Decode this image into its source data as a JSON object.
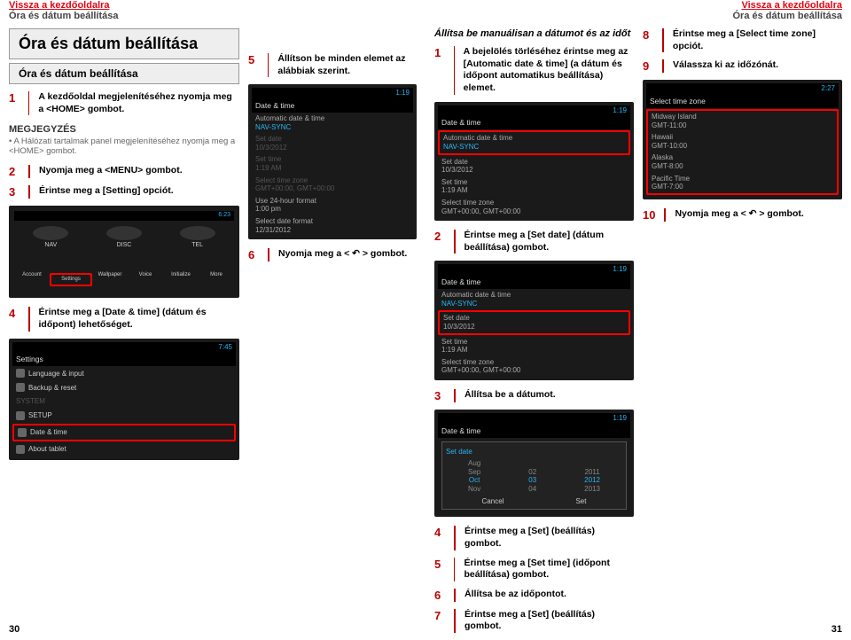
{
  "header": {
    "home": "Vissza a kezdőoldalra",
    "crumb": "Óra és dátum beállítása"
  },
  "left": {
    "title": "Óra és dátum beállítása",
    "subtitle": "Óra és dátum beállítása",
    "s1": "A kezdőoldal megjelenítéséhez nyomja meg a <HOME> gombot.",
    "note_t": "MEGJEGYZÉS",
    "note_b": "• A Hálózati tartalmak panel megjelenítéséhez nyomja meg a <HOME> gombot.",
    "s2": "Nyomja meg a <MENU> gombot.",
    "s3": "Érintse meg a [Setting] opciót.",
    "s4": "Érintse meg a [Date & time] (dátum és időpont) lehetőséget.",
    "s5": "Állítson be minden elemet az alábbiak szerint.",
    "s6": "Nyomja meg a < ↶ > gombot.",
    "time1": "6:23",
    "time2": "7:45",
    "time3": "1:19",
    "nav": "NAV",
    "disc": "DISC",
    "tel": "TEL",
    "ir": {
      "account": "Account",
      "settings": "Settings",
      "wallpaper": "Wallpaper",
      "voice": "Voice",
      "init": "Initialize",
      "more": "More"
    },
    "set": {
      "title": "Settings",
      "lang": "Language & input",
      "backup": "Backup & reset",
      "system": "SYSTEM",
      "setup": "SETUP",
      "dt": "Date & time",
      "about": "About tablet"
    },
    "dt": {
      "title": "Date & time",
      "auto": "Automatic date & time",
      "nav": "NAV-SYNC",
      "sd": "Set date",
      "sdv": "10/3/2012",
      "st": "Set time",
      "stv": "1:19 AM",
      "tz": "Select time zone",
      "tzv": "GMT+00:00, GMT+00:00",
      "u24": "Use 24-hour format",
      "u24v": "1:00 pm",
      "sdf": "Select date format",
      "sdfv": "12/31/2012"
    },
    "pagenum": "30"
  },
  "right": {
    "sub": "Állítsa be manuálisan a dátumot és az időt",
    "s1": "A bejelölés törléséhez érintse meg az [Automatic date & time] (a dátum és időpont automatikus beállítása) elemet.",
    "s2": "Érintse meg a [Set date] (dátum beállítása) gombot.",
    "s3": "Állítsa be a dátumot.",
    "s4": "Érintse meg a [Set] (beállítás) gombot.",
    "s5": "Érintse meg a [Set time] (időpont beállítása) gombot.",
    "s6": "Állítsa be az időpontot.",
    "s7": "Érintse meg a [Set] (beállítás) gombot.",
    "s8": "Érintse meg a [Select time zone] opciót.",
    "s9": "Válassza ki az időzónát.",
    "s10": "Nyomja meg a < ↶ > gombot.",
    "time": "1:19",
    "time2": "2:27",
    "dt": {
      "title": "Date & time",
      "auto": "Automatic date & time",
      "nav": "NAV-SYNC",
      "sd": "Set date",
      "sdv": "10/3/2012",
      "st": "Set time",
      "stv": "1:19 AM",
      "tz": "Select time zone",
      "tzv": "GMT+00:00, GMT+00:00"
    },
    "dlg": {
      "title": "Set date",
      "cancel": "Cancel",
      "set": "Set",
      "sep": "Sep",
      "oct": "Oct",
      "nov": "Nov",
      "d02": "02",
      "d03": "03",
      "d04": "04",
      "y11": "2011",
      "y12": "2012",
      "y13": "2013",
      "aug": "Aug"
    },
    "tz": {
      "title": "Select time zone",
      "mi": "Midway Island",
      "miv": "GMT-11:00",
      "hw": "Hawaii",
      "hwv": "GMT-10:00",
      "ak": "Alaska",
      "akv": "GMT-8:00",
      "pt": "Pacific Time",
      "ptv": "GMT-7:00"
    },
    "pagenum": "31"
  }
}
